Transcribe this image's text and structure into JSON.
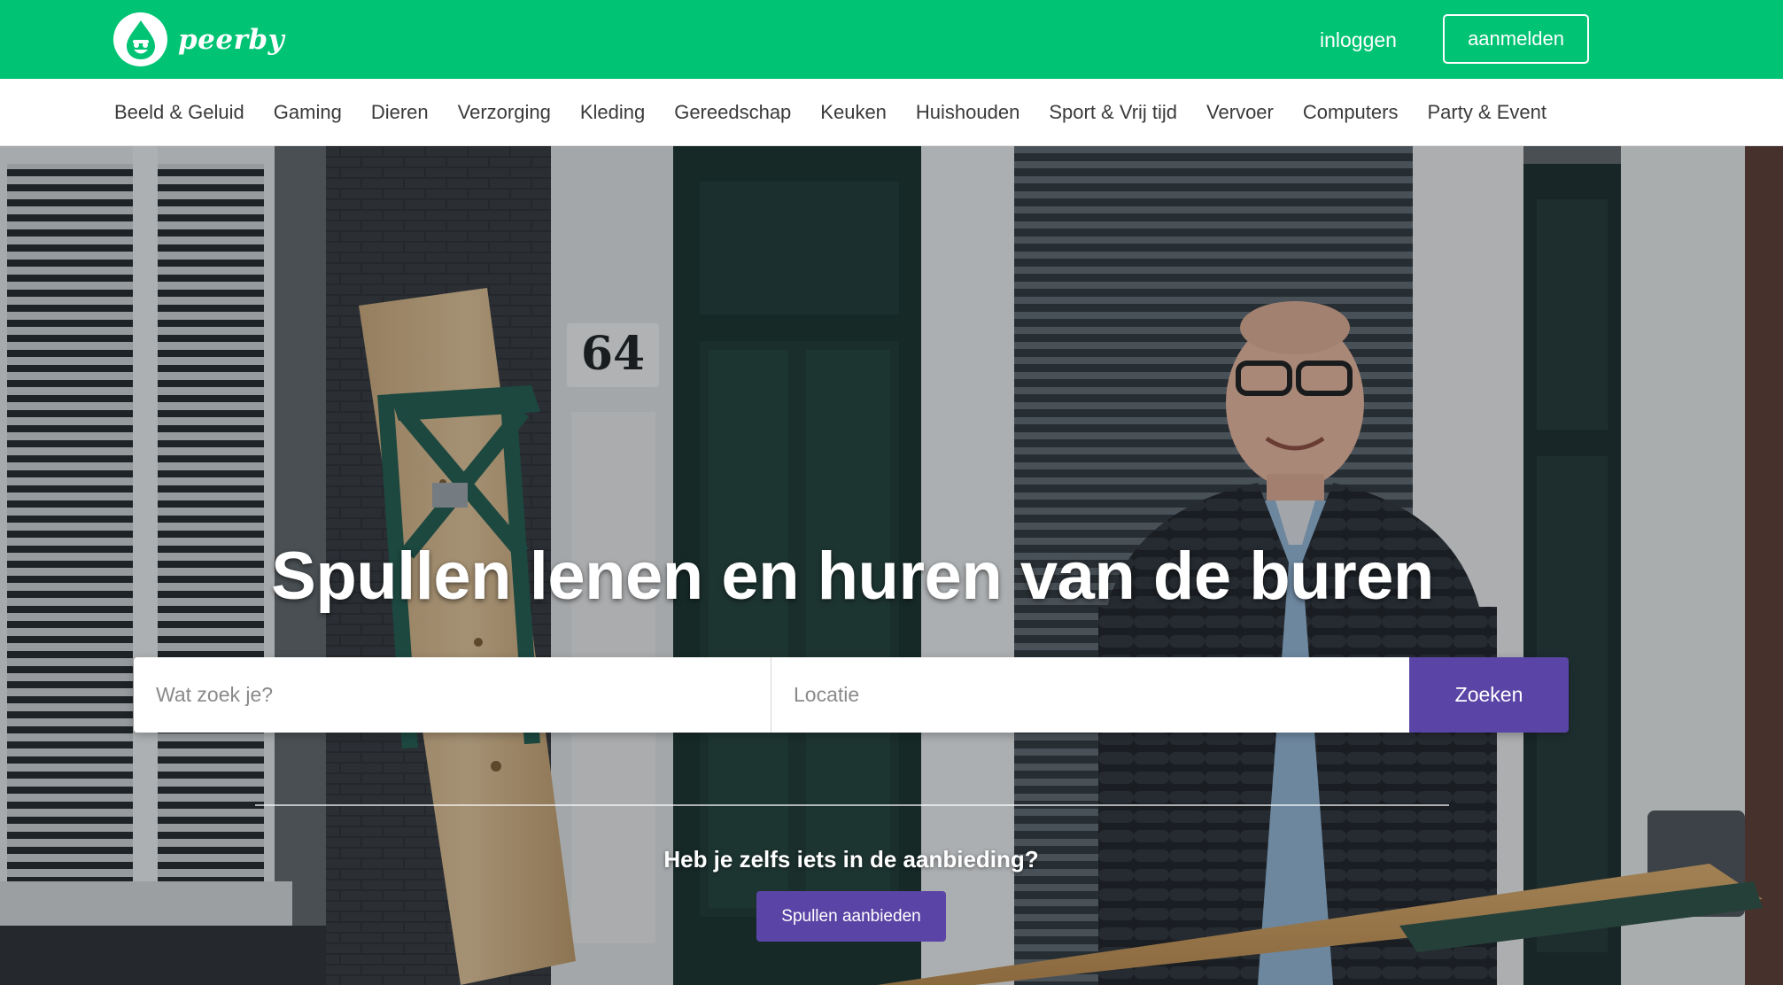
{
  "brand": {
    "name": "peerby",
    "color": "#00c374",
    "accent": "#5a45a6"
  },
  "header": {
    "login_label": "inloggen",
    "signup_label": "aanmelden"
  },
  "categories": [
    "Beeld & Geluid",
    "Gaming",
    "Dieren",
    "Verzorging",
    "Kleding",
    "Gereedschap",
    "Keuken",
    "Huishouden",
    "Sport & Vrij tijd",
    "Vervoer",
    "Computers",
    "Party & Event"
  ],
  "hero": {
    "headline": "Spullen lenen en huren van de buren",
    "house_number": "64",
    "search": {
      "what_placeholder": "Wat zoek je?",
      "where_placeholder": "Locatie",
      "submit_label": "Zoeken"
    },
    "offer_question": "Heb je zelfs iets in de aanbieding?",
    "offer_button": "Spullen aanbieden"
  }
}
